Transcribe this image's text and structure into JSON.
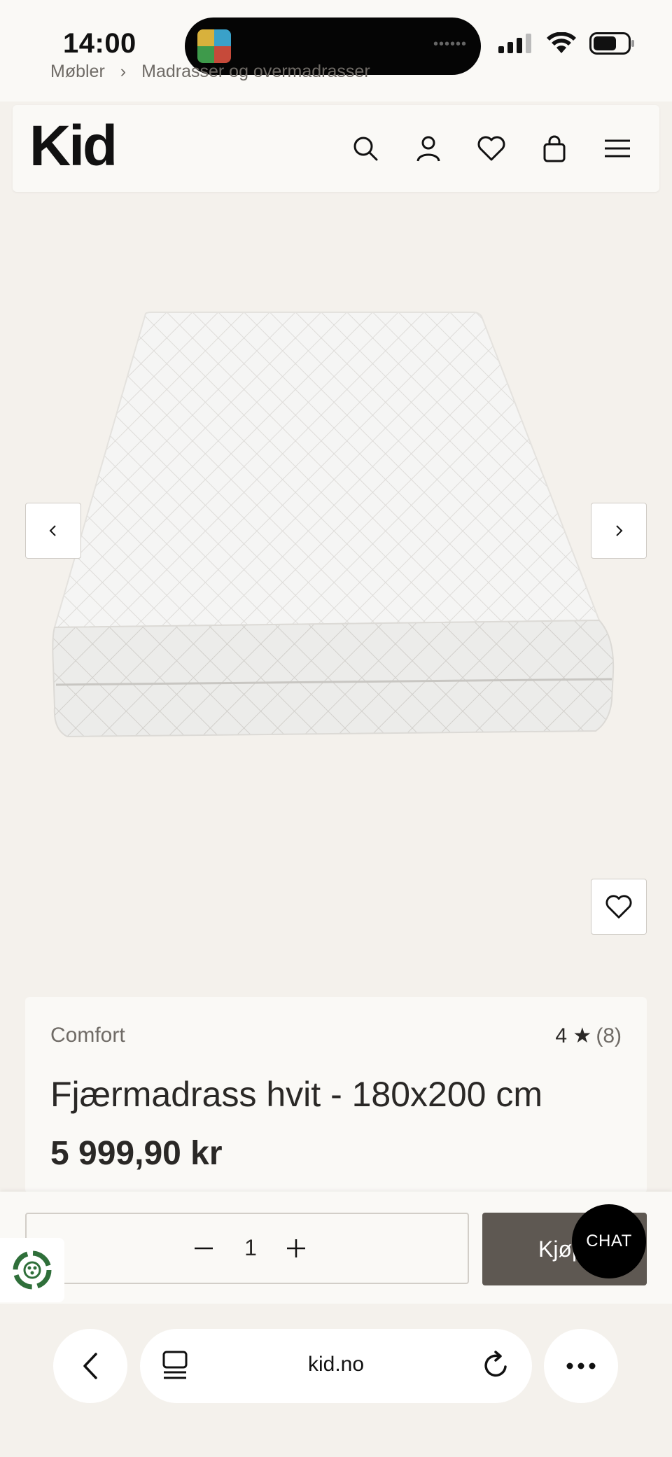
{
  "status_bar": {
    "time": "14:00",
    "island_dots": "••••••"
  },
  "breadcrumb": {
    "items": [
      "Møbler",
      "Madrasser og overmadrasser"
    ],
    "separator": "›"
  },
  "header": {
    "logo": "Kid",
    "icons": [
      "search-icon",
      "user-icon",
      "heart-icon",
      "bag-icon",
      "menu-icon"
    ]
  },
  "gallery": {
    "prev_icon": "chevron-left-icon",
    "next_icon": "chevron-right-icon",
    "favorite_icon": "heart-icon"
  },
  "product": {
    "brand": "Comfort",
    "rating": "4 ★",
    "review_count": "(8)",
    "title": "Fjærmadrass hvit - 180x200 cm",
    "price": "5 999,90 kr"
  },
  "purchase": {
    "quantity": "1",
    "buy_label": "Kjøp",
    "chat_label": "CHAT"
  },
  "browser": {
    "url": "kid.no"
  },
  "colors": {
    "page_bg": "#f4f1ec",
    "card_bg": "#faf9f6",
    "buy_button": "#5e5852",
    "chat_button": "#000000",
    "recycle_green": "#2f6f3a"
  }
}
